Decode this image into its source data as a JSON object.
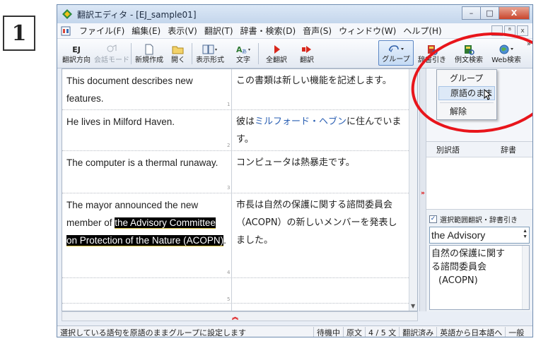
{
  "step_badge": "1",
  "window": {
    "title": "翻訳エディタ - [EJ_sample01]",
    "controls": {
      "minimize": "–",
      "maximize": "□",
      "close": "X"
    }
  },
  "menubar": {
    "items": [
      "ファイル(F)",
      "編集(E)",
      "表示(V)",
      "翻訳(T)",
      "辞書・検索(D)",
      "音声(S)",
      "ウィンドウ(W)",
      "ヘルプ(H)"
    ],
    "mdi_controls": {
      "minimize": "_",
      "restore": "ᴮ",
      "close": "x"
    }
  },
  "toolbar": {
    "direction": {
      "icon_text": "EJ",
      "label": "翻訳方向"
    },
    "conversation_mode": {
      "label": "会話モード"
    },
    "new": {
      "label": "新規作成"
    },
    "open": {
      "label": "開く"
    },
    "display_format": {
      "label": "表示形式"
    },
    "font": {
      "label": "文字"
    },
    "translate_all": {
      "label": "全翻訳"
    },
    "translate": {
      "label": "翻訳"
    },
    "group": {
      "label": "グループ"
    },
    "dictionary_lookup": {
      "label": "辞書引き"
    },
    "example_search": {
      "label": "例文検索"
    },
    "web_search": {
      "label": "Web検索"
    }
  },
  "group_menu": {
    "items": [
      "グループ",
      "原語のまま",
      "解除"
    ],
    "hovered": "原語のまま"
  },
  "document": {
    "rows": [
      {
        "num": "1",
        "source": "This document describes new features.",
        "target": "この書類は新しい機能を記述します。"
      },
      {
        "num": "2",
        "source": "He lives in Milford Haven.",
        "target_prefix": "彼は",
        "target_link": "ミルフォード・ヘブン",
        "target_suffix": "に住んでいます。"
      },
      {
        "num": "3",
        "source": "The computer is a thermal runaway.",
        "target": "コンピュータは熱暴走です。"
      },
      {
        "num": "4",
        "source_prefix": "The mayor announced the new member of ",
        "source_selected": "the Advisory Committee on Protection of the Nature (ACOPN)",
        "source_suffix": ".",
        "target": "市長は自然の保護に関する諮問委員会（ACOPN）の新しいメンバーを発表しました。"
      },
      {
        "num": "5",
        "source": "",
        "target": ""
      }
    ]
  },
  "right_panel": {
    "col_alt_translation": "別訳語",
    "col_dictionary": "辞書",
    "checkbox_label": "選択範囲翻訳・辞書引き",
    "checkbox_checked": true,
    "term": "the Advisory",
    "translation_lines": [
      "自然の保護に関す",
      "る諮問委員会",
      "(ACOPN)"
    ]
  },
  "statusbar": {
    "message": "選択している語句を原語のままグループに設定します",
    "state": "待機中",
    "view": "原文",
    "position": "4 / 5 文",
    "translated": "翻訳済み",
    "direction": "英語から日本語へ",
    "field": "一般"
  },
  "colors": {
    "highlight_ring": "#e8151b",
    "selection_bg": "#000000",
    "link": "#2a5fb3",
    "titlebar": "#c4d6ec"
  }
}
